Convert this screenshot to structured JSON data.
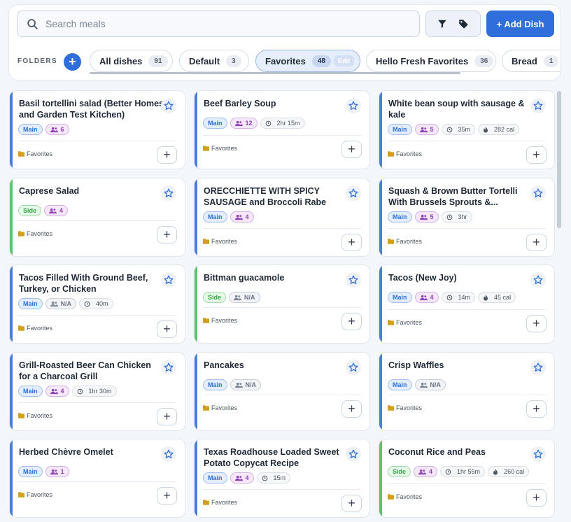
{
  "search": {
    "placeholder": "Search meals"
  },
  "toolbar": {
    "filter_icon": "filter-icon",
    "tags_icon": "tag-icon",
    "add_dish_label": "+ Add Dish"
  },
  "folders": {
    "label": "FOLDERS",
    "add_label": "+",
    "items": [
      {
        "label": "All dishes",
        "count": "91"
      },
      {
        "label": "Default",
        "count": "3"
      },
      {
        "label": "Favorites",
        "count": "48",
        "active": true,
        "edit_label": "Edit"
      },
      {
        "label": "Hello Fresh Favorites",
        "count": "36"
      },
      {
        "label": "Bread",
        "count": "1"
      }
    ]
  },
  "colors": {
    "accent": "#2f6fdc",
    "main_stripe": "#4a7fd6",
    "side_stripe": "#5cc56b"
  },
  "cards": [
    {
      "title": "Basil tortellini salad (Better Homes and Garden Test Kitchen)",
      "type": "Main",
      "servings": "6",
      "time": "",
      "cal": "",
      "folder": "Favorites"
    },
    {
      "title": "Beef Barley Soup",
      "type": "Main",
      "servings": "12",
      "time": "2hr 15m",
      "cal": "",
      "folder": "Favorites"
    },
    {
      "title": "White bean soup with sausage & kale",
      "type": "Main",
      "servings": "5",
      "time": "35m",
      "cal": "282 cal",
      "folder": "Favorites"
    },
    {
      "title": "Caprese Salad",
      "type": "Side",
      "servings": "4",
      "time": "",
      "cal": "",
      "folder": "Favorites"
    },
    {
      "title": "ORECCHIETTE WITH SPICY SAUSAGE and Broccoli Rabe",
      "type": "Main",
      "servings": "4",
      "time": "",
      "cal": "",
      "folder": "Favorites"
    },
    {
      "title": "Squash & Brown Butter Tortelli With Brussels Sprouts &...",
      "type": "Main",
      "servings": "5",
      "time": "3hr",
      "cal": "",
      "folder": "Favorites"
    },
    {
      "title": "Tacos Filled With Ground Beef, Turkey, or Chicken",
      "type": "Main",
      "servings": "N/A",
      "time": "40m",
      "cal": "",
      "folder": "Favorites"
    },
    {
      "title": "Bittman guacamole",
      "type": "Side",
      "servings": "N/A",
      "time": "",
      "cal": "",
      "folder": "Favorites"
    },
    {
      "title": "Tacos (New Joy)",
      "type": "Main",
      "servings": "4",
      "time": "14m",
      "cal": "45 cal",
      "folder": "Favorites"
    },
    {
      "title": "Grill-Roasted Beer Can Chicken for a Charcoal Grill",
      "type": "Main",
      "servings": "4",
      "time": "1hr 30m",
      "cal": "",
      "folder": "Favorites"
    },
    {
      "title": "Pancakes",
      "type": "Main",
      "servings": "N/A",
      "time": "",
      "cal": "",
      "folder": "Favorites"
    },
    {
      "title": "Crisp Waffles",
      "type": "Main",
      "servings": "N/A",
      "time": "",
      "cal": "",
      "folder": "Favorites"
    },
    {
      "title": "Herbed Chèvre Omelet",
      "type": "Main",
      "servings": "1",
      "time": "",
      "cal": "",
      "folder": "Favorites"
    },
    {
      "title": "Texas Roadhouse Loaded Sweet Potato Copycat Recipe",
      "type": "Main",
      "servings": "4",
      "time": "15m",
      "cal": "",
      "folder": "Favorites"
    },
    {
      "title": "Coconut Rice and Peas",
      "type": "Side",
      "servings": "4",
      "time": "1hr 55m",
      "cal": "260 cal",
      "folder": "Favorites"
    }
  ]
}
